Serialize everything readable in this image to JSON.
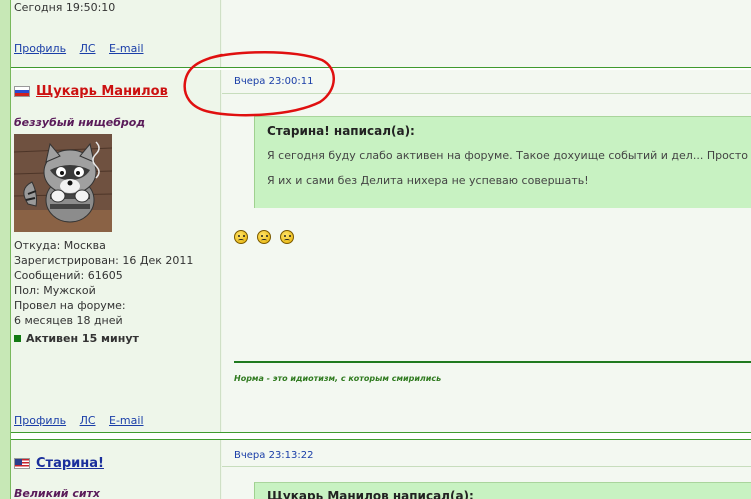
{
  "previous_post": {
    "last_seen": "Сегодня 19:50:10",
    "links": {
      "profile": "Профиль",
      "pm": "ЛС",
      "email": "E-mail"
    }
  },
  "post1": {
    "username": "Щукарь Манилов",
    "flag": "ru-flag-icon",
    "user_title": "беззубый нищеброд",
    "avatar": "raccoon-avatar",
    "info": {
      "location": "Откуда: Москва",
      "registered": "Зарегистрирован: 16 Дек 2011",
      "messages": "Сообщений: 61605",
      "gender": "Пол: Мужской",
      "time_label": "Провел на форуме:",
      "time_value": "6 месяцев 18 дней"
    },
    "status": "Активен 15 минут",
    "date": "Вчера 23:00:11",
    "quote": {
      "title": "Старина! написал(а):",
      "line1": "Я сегодня буду слабо активен на форуме. Такое дохуище событий и дел... Просто а",
      "line2": "Я их и сами без Делита нихера не успеваю совершать!"
    },
    "smilies": [
      "sad-smiley-icon",
      "sad-smiley-icon",
      "sad-smiley-icon"
    ],
    "signature": "Норма - это идиотизм, с которым смирились",
    "links": {
      "profile": "Профиль",
      "pm": "ЛС",
      "email": "E-mail"
    }
  },
  "post2": {
    "username": "Старина!",
    "flag": "us-flag-icon",
    "user_title": "Великий ситх",
    "date": "Вчера 23:13:22",
    "quote_title": "Щукарь Манилов написал(а):"
  },
  "colors": {
    "accent_green": "#3f9a2e",
    "link_blue": "#1a3ea8",
    "username_red": "#cc1111",
    "annotation_red": "#e01010"
  }
}
